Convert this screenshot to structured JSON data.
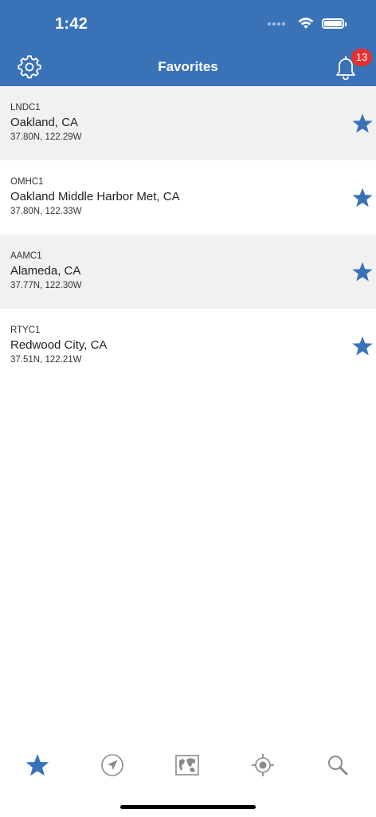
{
  "status_bar": {
    "time": "1:42"
  },
  "nav": {
    "title": "Favorites",
    "notification_count": "13"
  },
  "colors": {
    "header": "#3a72b8",
    "accent_star": "#3a72b8",
    "badge": "#e53030",
    "row_shaded": "#f1f1f1"
  },
  "favorites": [
    {
      "id": "LNDC1",
      "name": "Oakland, CA",
      "coords": "37.80N, 122.29W"
    },
    {
      "id": "OMHC1",
      "name": "Oakland Middle Harbor Met, CA",
      "coords": "37.80N, 122.33W"
    },
    {
      "id": "AAMC1",
      "name": "Alameda, CA",
      "coords": "37.77N, 122.30W"
    },
    {
      "id": "RTYC1",
      "name": "Redwood City, CA",
      "coords": "37.51N, 122.21W"
    }
  ],
  "tabbar": {
    "tabs": [
      {
        "icon": "star-icon",
        "selected": true
      },
      {
        "icon": "location-arrow-icon",
        "selected": false
      },
      {
        "icon": "world-map-icon",
        "selected": false
      },
      {
        "icon": "crosshair-icon",
        "selected": false
      },
      {
        "icon": "search-icon",
        "selected": false
      }
    ]
  }
}
